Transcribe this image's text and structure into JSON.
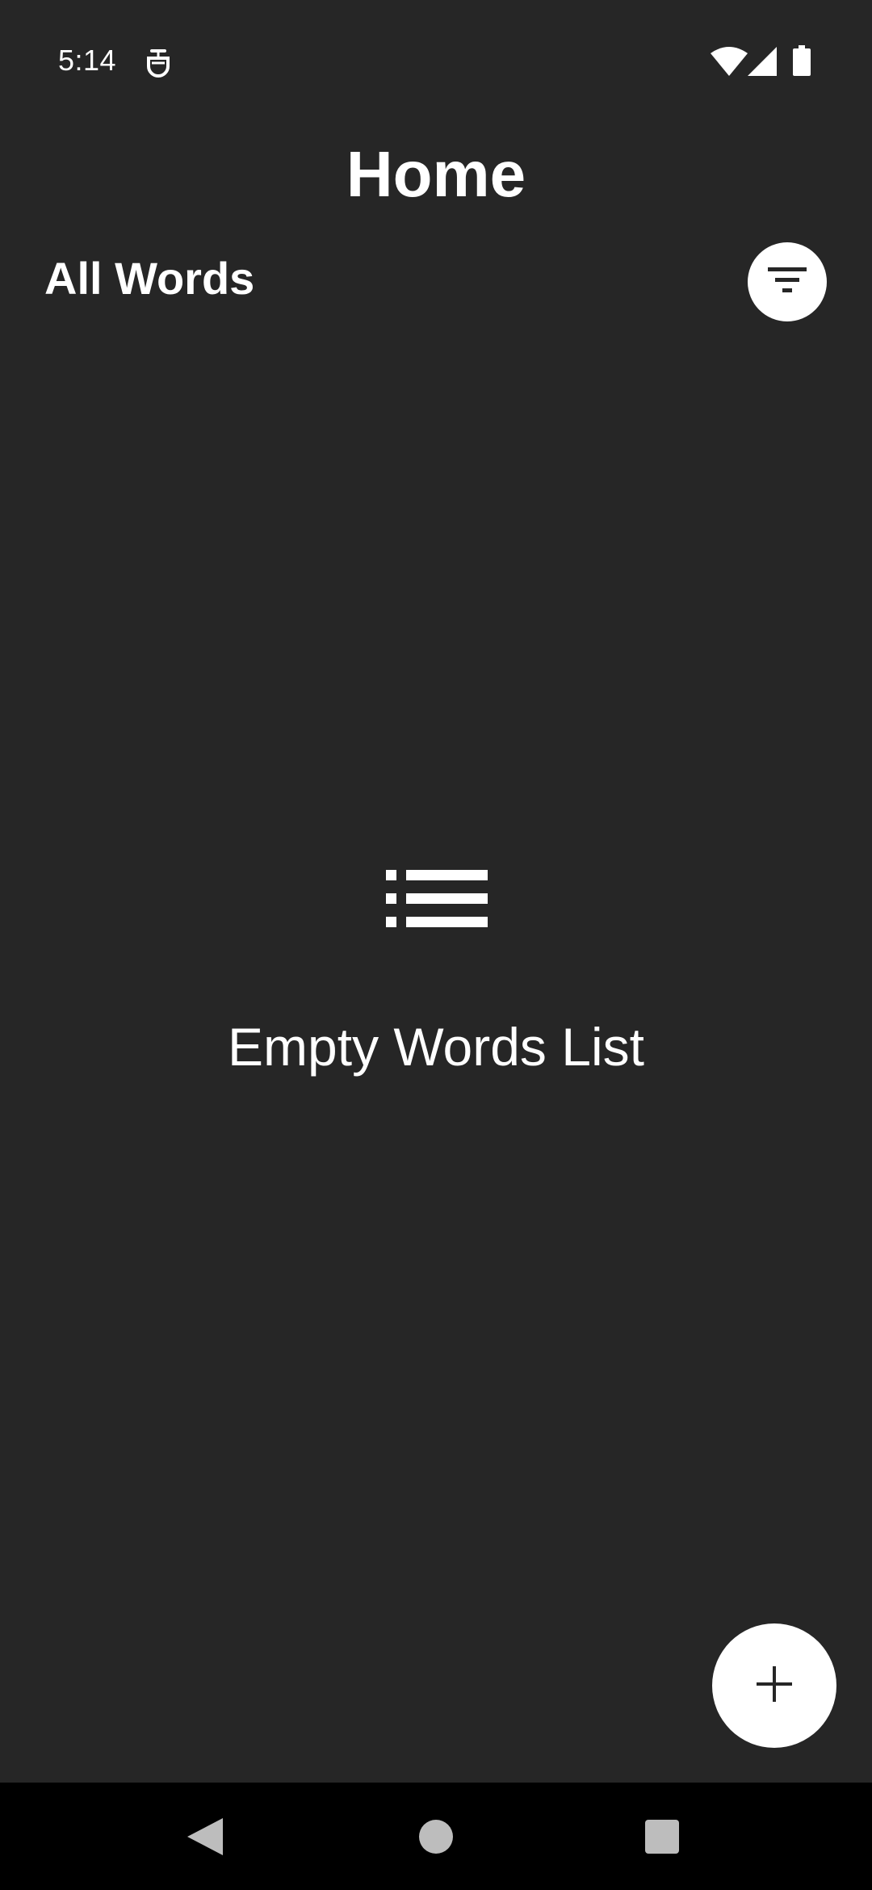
{
  "status_bar": {
    "time": "5:14",
    "notification_icon": "notification-icon",
    "wifi_icon": "wifi-icon",
    "signal_icon": "signal-icon",
    "battery_icon": "battery-icon"
  },
  "header": {
    "title": "Home"
  },
  "section": {
    "title": "All Words",
    "filter_icon": "filter-icon"
  },
  "empty_state": {
    "icon": "list-icon",
    "message": "Empty Words List"
  },
  "fab": {
    "icon": "add-icon"
  },
  "nav_bar": {
    "back_icon": "back-icon",
    "home_icon": "home-icon",
    "recents_icon": "recents-icon"
  },
  "colors": {
    "background": "#262626",
    "text": "#ffffff",
    "button_bg": "#ffffff",
    "icon_dark": "#262626",
    "nav_bg": "#000000",
    "nav_icon": "#bdbdbd"
  }
}
